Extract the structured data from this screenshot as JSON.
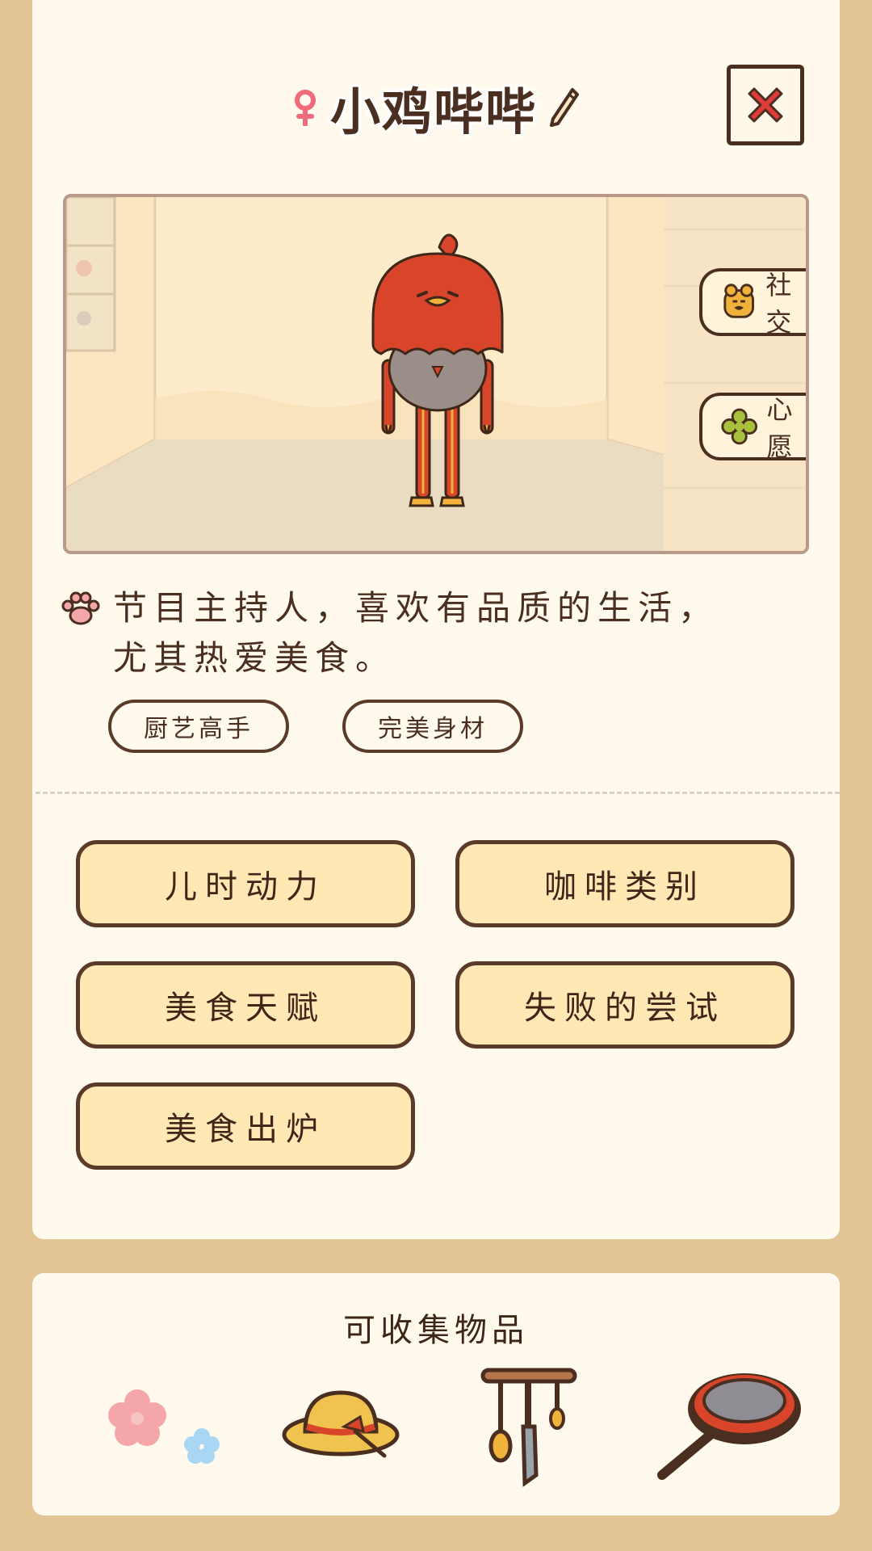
{
  "header": {
    "name": "小鸡哔哔",
    "gender_icon": "female-symbol-icon",
    "edit_icon": "pencil-icon",
    "close_icon": "close-x-icon"
  },
  "scene": {
    "social_label": "社交",
    "wish_label": "心愿"
  },
  "description": {
    "text_line1": "节目主持人，喜欢有品质的生活，",
    "text_line2": "尤其热爱美食。",
    "icon": "paw-print-icon"
  },
  "tags": [
    {
      "label": "厨艺高手"
    },
    {
      "label": "完美身材"
    }
  ],
  "stories": [
    {
      "label": "儿时动力"
    },
    {
      "label": "咖啡类别"
    },
    {
      "label": "美食天赋"
    },
    {
      "label": "失败的尝试"
    },
    {
      "label": "美食出炉"
    }
  ],
  "collectables": {
    "title": "可收集物品",
    "items": [
      "flowers-icon",
      "straw-hat-icon",
      "utensil-rack-icon",
      "frying-pan-icon"
    ]
  },
  "colors": {
    "background": "#e3c494",
    "card": "#fff9ee",
    "button_fill": "#ffe8b4",
    "outline": "#4a2e1f",
    "close_red": "#e03a3a",
    "chicken_red": "#d8452b"
  }
}
